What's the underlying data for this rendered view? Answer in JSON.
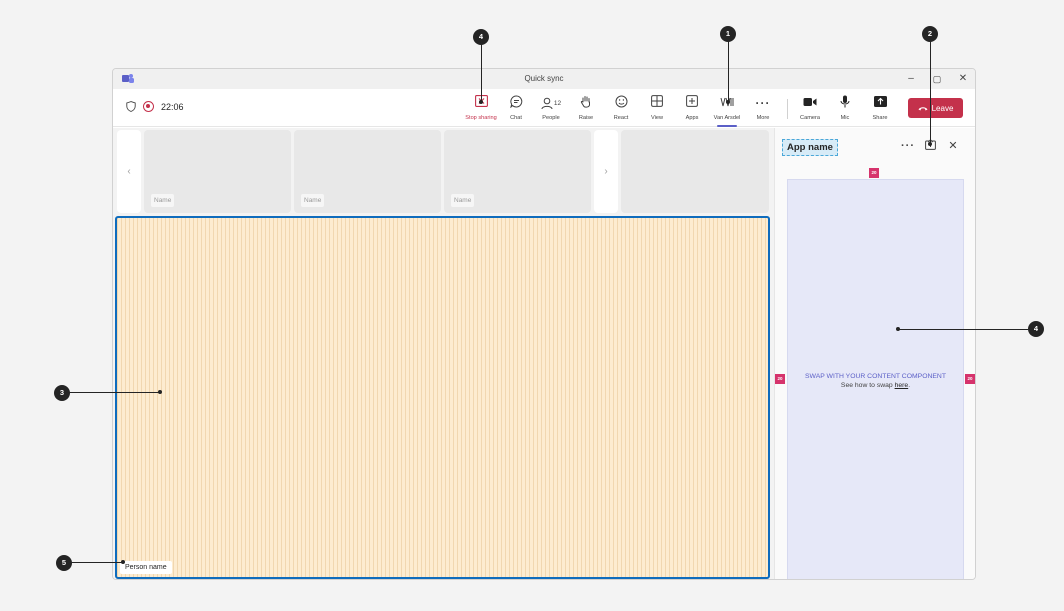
{
  "window": {
    "title": "Quick sync",
    "controls": {
      "minimize": "–",
      "maximize": "▢",
      "close": "✕"
    }
  },
  "toolbar": {
    "timer": "22:06",
    "people_count": "12",
    "buttons": {
      "stop_sharing": "Stop sharing",
      "chat": "Chat",
      "people": "People",
      "raise": "Raise",
      "react": "React",
      "view": "View",
      "apps": "Apps",
      "app": "Van Arsdel",
      "more": "More",
      "camera": "Camera",
      "mic": "Mic",
      "share": "Share"
    },
    "leave_label": "Leave"
  },
  "stage": {
    "tiles": [
      "Name",
      "Name",
      "Name"
    ],
    "person_name": "Person name"
  },
  "panel": {
    "app_name": "App name",
    "content_title": "SWAP WITH YOUR CONTENT COMPONENT",
    "content_sub_prefix": "See how to swap ",
    "content_sub_link": "here",
    "content_sub_suffix": ".",
    "spacing_labels": {
      "top": "20",
      "left": "20",
      "right": "20"
    }
  },
  "callouts": [
    "1",
    "2",
    "3",
    "4",
    "4",
    "5"
  ],
  "colors": {
    "accent": "#5b5fc7",
    "leave": "#c4314b",
    "share_border": "#0f6cbd",
    "share_fill": "#fdecd0",
    "content_fill": "#e6e8f8",
    "spacer": "#d6336c"
  }
}
